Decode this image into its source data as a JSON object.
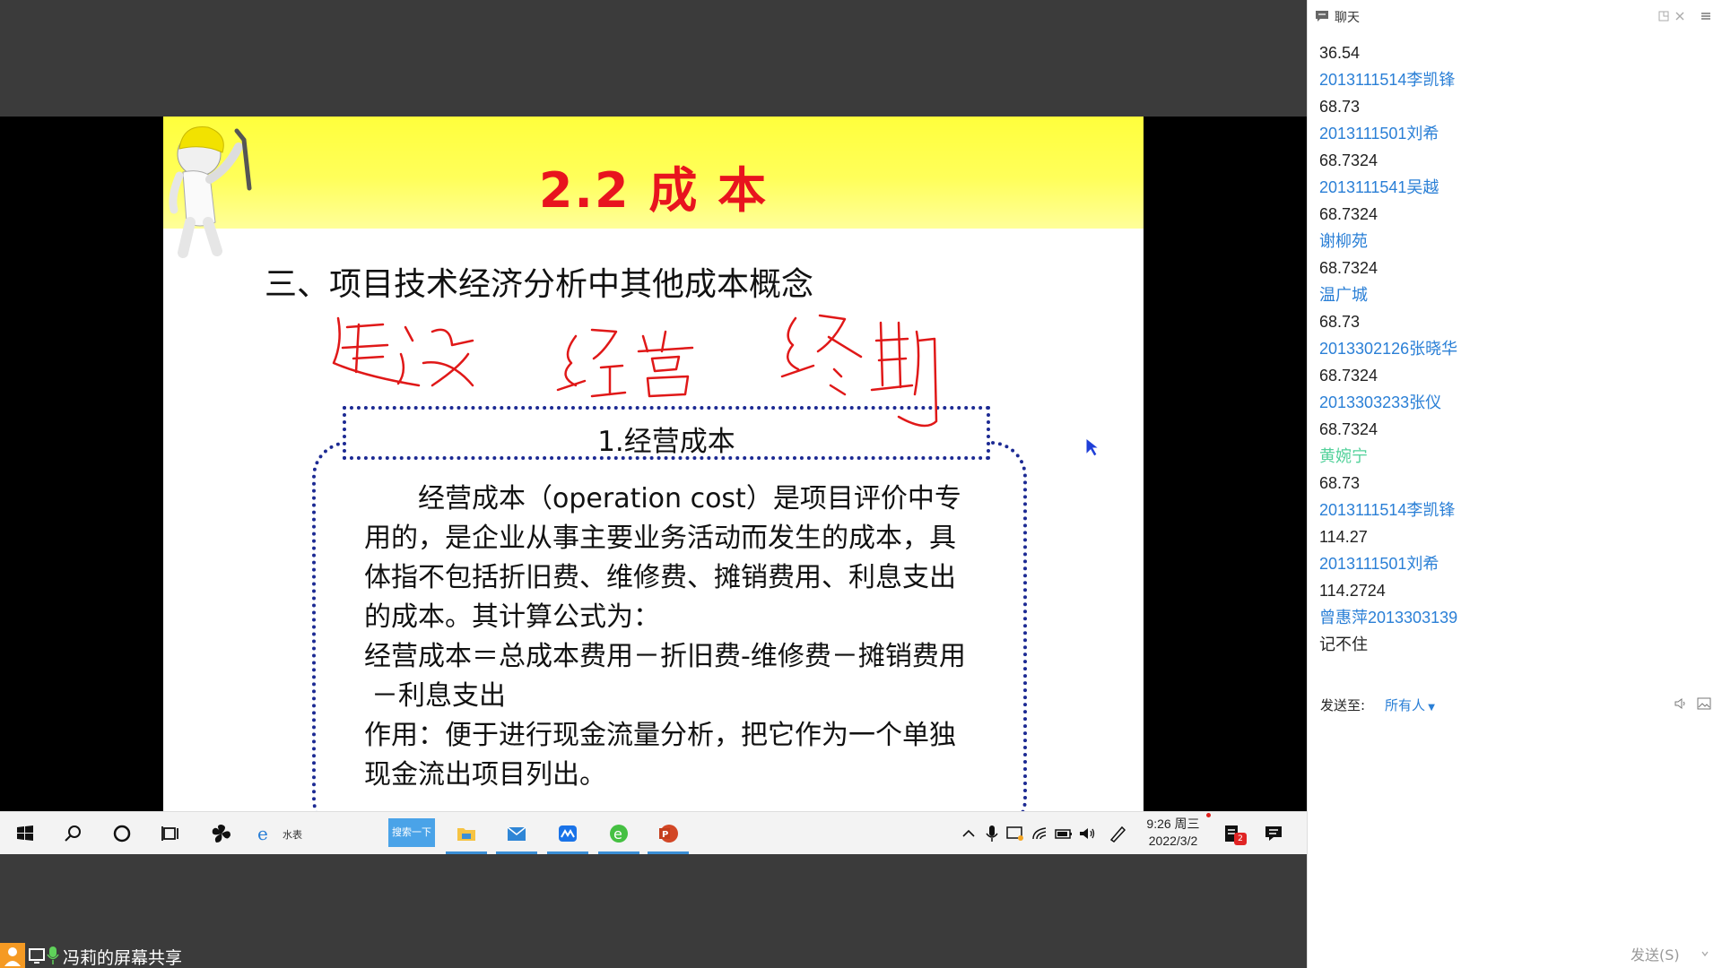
{
  "slide": {
    "title": "2.2 成  本",
    "heading": "三、项目技术经济分析中其他成本概念",
    "box_title": "1.经营成本",
    "body_lines": [
      "　　经营成本（operation cost）是项目评价中专",
      "用的，是企业从事主要业务活动而发生的成本，具",
      "体指不包括折旧费、维修费、摊销费用、利息支出",
      "的成本。其计算公式为：",
      "经营成本＝总成本费用－折旧费-维修费－摊销费用",
      "－利息支出",
      "作用：便于进行现金流量分析，把它作为一个单独",
      "现金流出项目列出。"
    ],
    "title_color": "#e8141e",
    "box_border_color": "#1c2a93"
  },
  "taskbar": {
    "search_button_label": "搜索一下",
    "ie_label": "水表",
    "clock_time": "9:26 周三",
    "clock_date": "2022/3/2",
    "notification_count": "2"
  },
  "share_status": {
    "label": "冯莉的屏幕共享"
  },
  "chat": {
    "title": "聊天",
    "messages": [
      {
        "kind": "text",
        "value": "36.54"
      },
      {
        "kind": "name",
        "value": "2013111514李凯锋"
      },
      {
        "kind": "text",
        "value": "68.73"
      },
      {
        "kind": "name",
        "value": "2013111501刘希"
      },
      {
        "kind": "text",
        "value": "68.7324"
      },
      {
        "kind": "name",
        "value": "2013111541吴越"
      },
      {
        "kind": "text",
        "value": "68.7324"
      },
      {
        "kind": "name",
        "value": "谢柳苑"
      },
      {
        "kind": "text",
        "value": "68.7324"
      },
      {
        "kind": "name",
        "value": "温广城"
      },
      {
        "kind": "text",
        "value": "68.73"
      },
      {
        "kind": "name",
        "value": "2013302126张晓华"
      },
      {
        "kind": "text",
        "value": "68.7324"
      },
      {
        "kind": "name",
        "value": "2013303233张仪"
      },
      {
        "kind": "text",
        "value": "68.7324"
      },
      {
        "kind": "name-green",
        "value": "黄婉宁"
      },
      {
        "kind": "text",
        "value": "68.73"
      },
      {
        "kind": "name",
        "value": "2013111514李凯锋"
      },
      {
        "kind": "text",
        "value": "114.27"
      },
      {
        "kind": "name",
        "value": "2013111501刘希"
      },
      {
        "kind": "text",
        "value": "114.2724"
      },
      {
        "kind": "name",
        "value": "曾惠萍2013303139"
      },
      {
        "kind": "text",
        "value": "记不住"
      }
    ],
    "send_to_label": "发送至:",
    "send_to_value": "所有人",
    "send_button": "发送(S)",
    "name_color": "#2a7fd6",
    "highlight_name_color": "#52d19a"
  }
}
